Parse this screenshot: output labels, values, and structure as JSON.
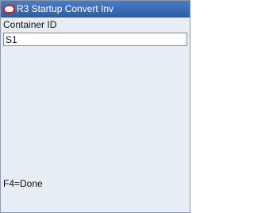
{
  "window": {
    "title": "R3 Startup Convert Inv",
    "logo_icon": "oracle-logo-icon",
    "title_bar_color": "#3a6db8",
    "background_color": "#e7edf5"
  },
  "form": {
    "container_id": {
      "label": "Container ID",
      "value": "S1"
    }
  },
  "footer": {
    "hint": "F4=Done"
  }
}
